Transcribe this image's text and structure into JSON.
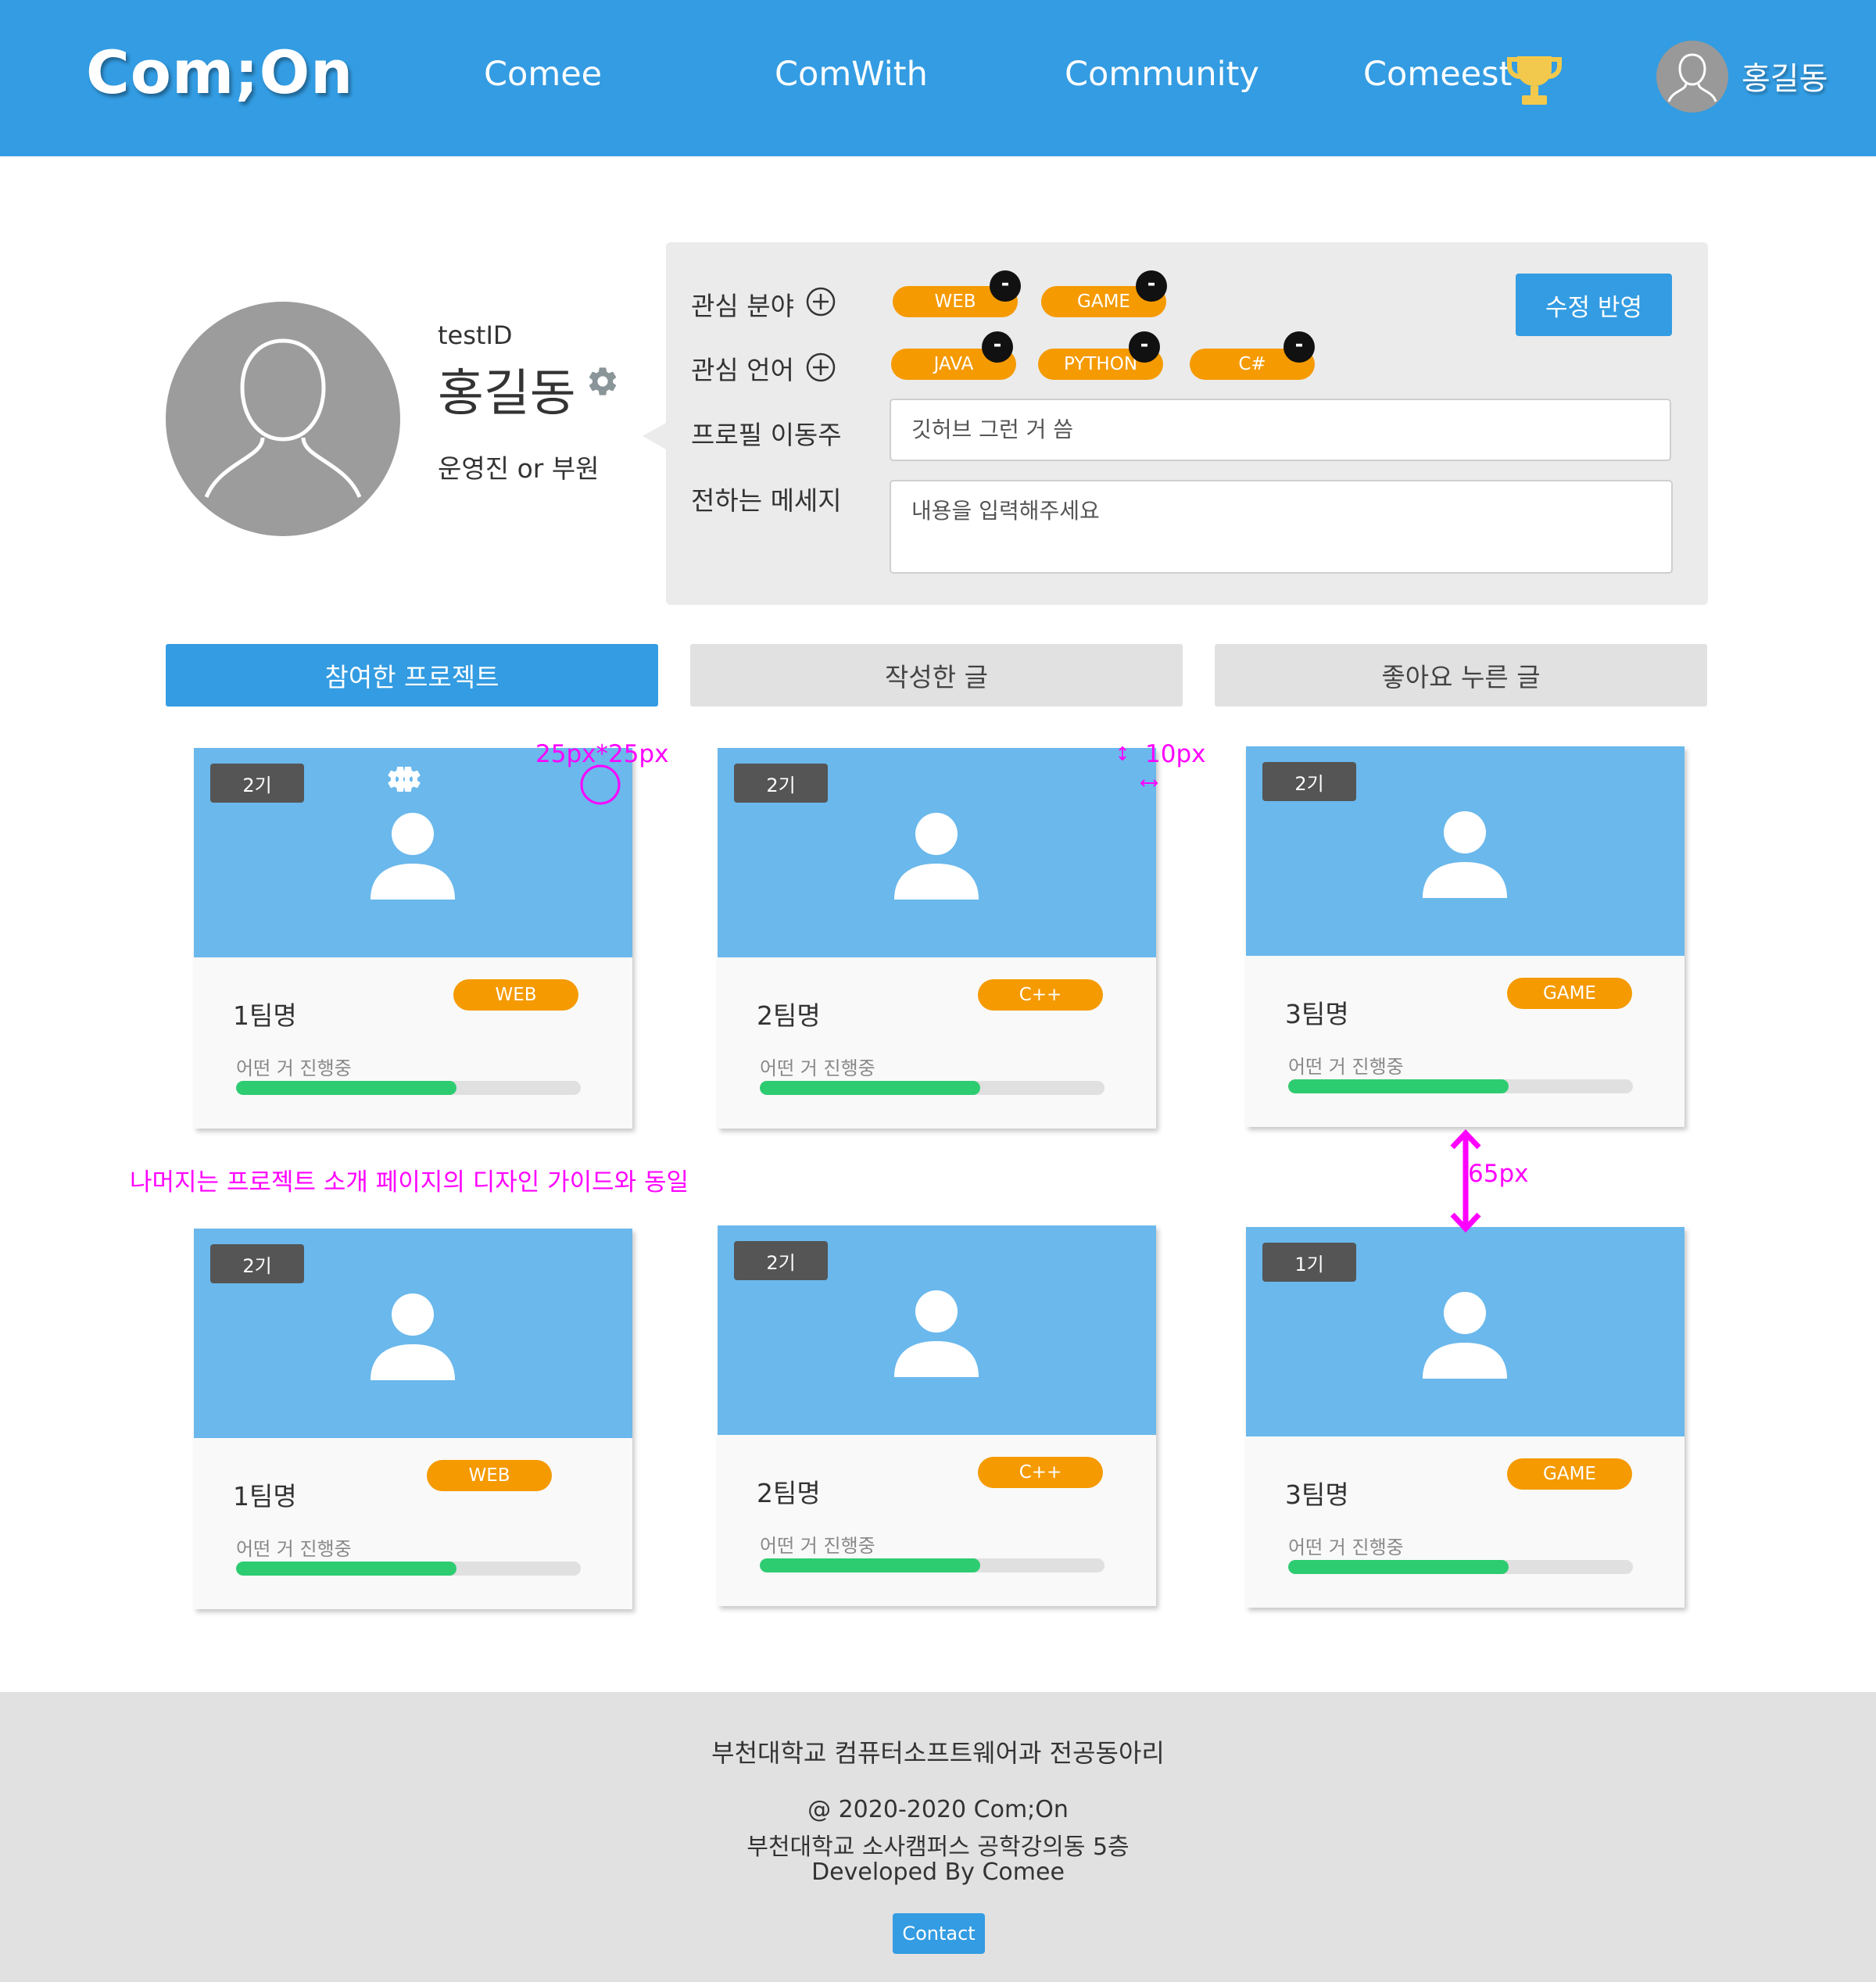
{
  "header": {
    "logo": "Com;On",
    "nav": [
      "Comee",
      "ComWith",
      "Community",
      "Comeest"
    ],
    "user_name": "홍길동",
    "icons": {
      "trophy": "trophy-icon",
      "avatar": "user-avatar-icon"
    }
  },
  "profile": {
    "id": "testID",
    "name": "홍길동",
    "role": "운영진 or 부원"
  },
  "edit": {
    "interest_field_label": "관심 분야",
    "interest_fields": [
      "WEB",
      "GAME"
    ],
    "interest_lang_label": "관심 언어",
    "interest_langs": [
      "JAVA",
      "PYTHON",
      "C#"
    ],
    "profile_link_label": "프로필 이동주",
    "profile_link_value": "깃허브 그런 거 씀",
    "message_label": "전하는 메세지",
    "message_placeholder": "내용을 입력해주세요",
    "save_label": "수정 반영",
    "minus_symbol": "-"
  },
  "tabs": [
    {
      "label": "참여한 프로젝트",
      "active": true
    },
    {
      "label": "작성한 글",
      "active": false
    },
    {
      "label": "좋아요 누른 글",
      "active": false
    }
  ],
  "cards": [
    {
      "generation": "2기",
      "team": "1팀명",
      "tag": "WEB",
      "status": "어떤 거 진행중",
      "progress": 0.64,
      "gear": true
    },
    {
      "generation": "2기",
      "team": "2팀명",
      "tag": "C++",
      "status": "어떤 거 진행중",
      "progress": 0.64,
      "gear": true
    },
    {
      "generation": "2기",
      "team": "3팀명",
      "tag": "GAME",
      "status": "어떤 거 진행중",
      "progress": 0.64,
      "gear": false
    },
    {
      "generation": "2기",
      "team": "1팀명",
      "tag": "WEB",
      "status": "어떤 거 진행중",
      "progress": 0.64,
      "gear": false
    },
    {
      "generation": "2기",
      "team": "2팀명",
      "tag": "C++",
      "status": "어떤 거 진행중",
      "progress": 0.64,
      "gear": false
    },
    {
      "generation": "1기",
      "team": "3팀명",
      "tag": "GAME",
      "status": "어떤 거 진행중",
      "progress": 0.64,
      "gear": false
    }
  ],
  "annotations": {
    "gear_size": "25px*25px",
    "gear_offset": "10px",
    "row_gap": "65px",
    "note": "나머지는 프로젝트 소개 페이지의 디자인 가이드와 동일"
  },
  "footer": {
    "title": "부천대학교 컴퓨터소프트웨어과 전공동아리",
    "copyright": "@ 2020-2020 Com;On",
    "address": "부천대학교 소사캠퍼스 공학강의동 5층",
    "developer": "Developed By Comee",
    "contact_label": "Contact"
  },
  "colors": {
    "primary": "#339ce2",
    "card_image": "#6ab8ec",
    "tag": "#f59a00",
    "progress": "#2ecc71",
    "annotation": "#ff00ff"
  }
}
